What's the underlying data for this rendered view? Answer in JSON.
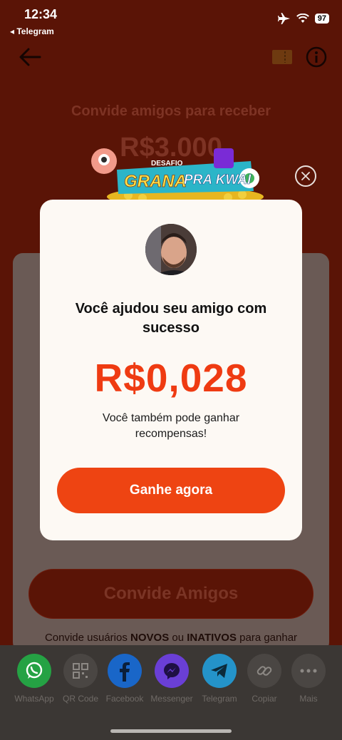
{
  "status": {
    "time": "12:34",
    "back_app": "◂ Telegram",
    "battery": "97"
  },
  "header": {
    "title": "Convide amigos para receber",
    "amount": "R$3.000"
  },
  "modal": {
    "title": "Você ajudou seu amigo com sucesso",
    "amount": "R$0,028",
    "subtitle": "Você também pode ganhar recompensas!",
    "cta_label": "Ganhe agora"
  },
  "banner": {
    "tag": "DESAFIO",
    "line1": "GRANA",
    "line2": "PRA KWAI"
  },
  "invite": {
    "button_label": "Convide Amigos",
    "desc_prefix": "Convide usuários ",
    "desc_new": "NOVOS",
    "desc_or": " ou ",
    "desc_inactive": "INATIVOS",
    "desc_suffix": " para ganhar"
  },
  "share": [
    {
      "label": "WhatsApp",
      "icon": "whatsapp-icon",
      "color": "#25a244"
    },
    {
      "label": "QR Code",
      "icon": "qr-code-icon",
      "color": "#4a4643"
    },
    {
      "label": "Facebook",
      "icon": "facebook-icon",
      "color": "#1966c8"
    },
    {
      "label": "Messenger",
      "icon": "messenger-icon",
      "color": "#6a3fd6"
    },
    {
      "label": "Telegram",
      "icon": "telegram-icon",
      "color": "#2493c9"
    },
    {
      "label": "Copiar",
      "icon": "link-icon",
      "color": "#4a4643"
    },
    {
      "label": "Mais",
      "icon": "more-icon",
      "color": "#4a4643"
    }
  ]
}
